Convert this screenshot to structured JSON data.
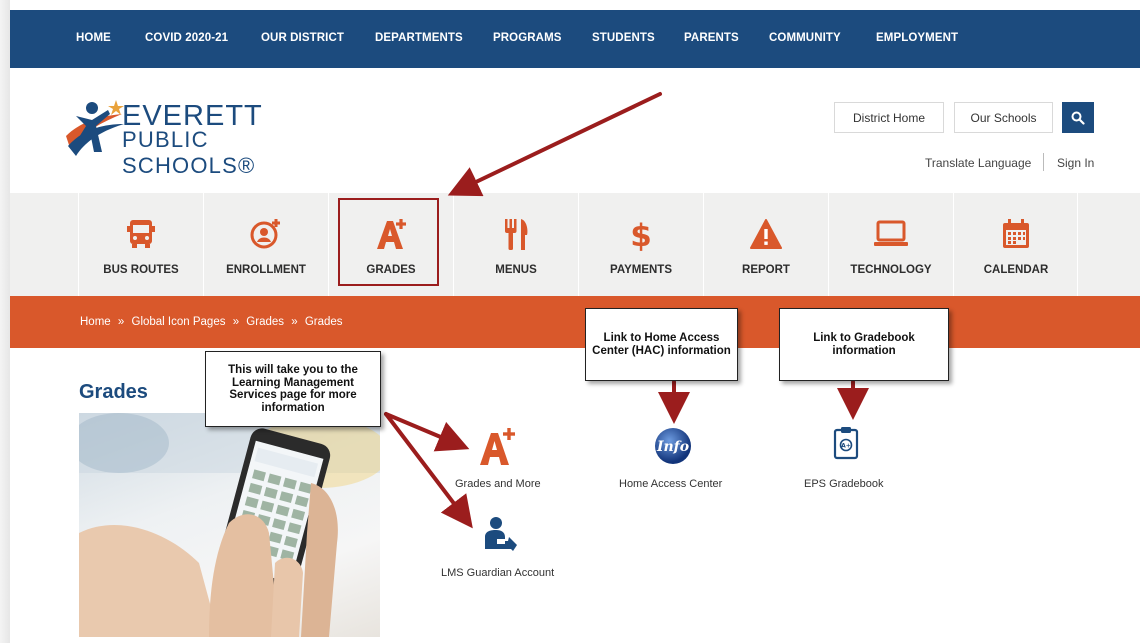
{
  "topnav": {
    "items": [
      "HOME",
      "COVID 2020-21",
      "OUR DISTRICT",
      "DEPARTMENTS",
      "PROGRAMS",
      "STUDENTS",
      "PARENTS",
      "COMMUNITY",
      "EMPLOYMENT"
    ]
  },
  "logo": {
    "line1": "EVERETT",
    "line2": "PUBLIC SCHOOLS®"
  },
  "header": {
    "district_home": "District Home",
    "our_schools": "Our Schools",
    "translate": "Translate Language",
    "sign_in": "Sign In"
  },
  "quick_icons": [
    {
      "label": "BUS ROUTES",
      "icon": "bus-icon",
      "color": "#d9582b"
    },
    {
      "label": "ENROLLMENT",
      "icon": "user-plus-icon",
      "color": "#d9582b"
    },
    {
      "label": "GRADES",
      "icon": "a-plus-icon",
      "color": "#d9582b"
    },
    {
      "label": "MENUS",
      "icon": "fork-knife-icon",
      "color": "#d9582b"
    },
    {
      "label": "PAYMENTS",
      "icon": "dollar-icon",
      "color": "#d9582b"
    },
    {
      "label": "REPORT",
      "icon": "warning-icon",
      "color": "#d9582b"
    },
    {
      "label": "TECHNOLOGY",
      "icon": "laptop-icon",
      "color": "#d9582b"
    },
    {
      "label": "CALENDAR",
      "icon": "calendar-icon",
      "color": "#d9582b"
    }
  ],
  "breadcrumb": [
    "Home",
    "»",
    "Global Icon Pages",
    "»",
    "Grades",
    "»",
    "Grades"
  ],
  "page": {
    "title": "Grades"
  },
  "links": {
    "grades_more": "Grades and More",
    "hac": "Home Access Center",
    "hac_icon_text": "Info",
    "gradebook": "EPS Gradebook",
    "lms": "LMS Guardian Account"
  },
  "callouts": {
    "lms": "This will take you to the Learning Management Services page for more information",
    "hac": "Link to Home Access Center (HAC) information",
    "gradebook": "Link to Gradebook information"
  },
  "colors": {
    "navy": "#1c4b7e",
    "orange": "#d9582b",
    "annotation_red": "#9b1d1d"
  }
}
